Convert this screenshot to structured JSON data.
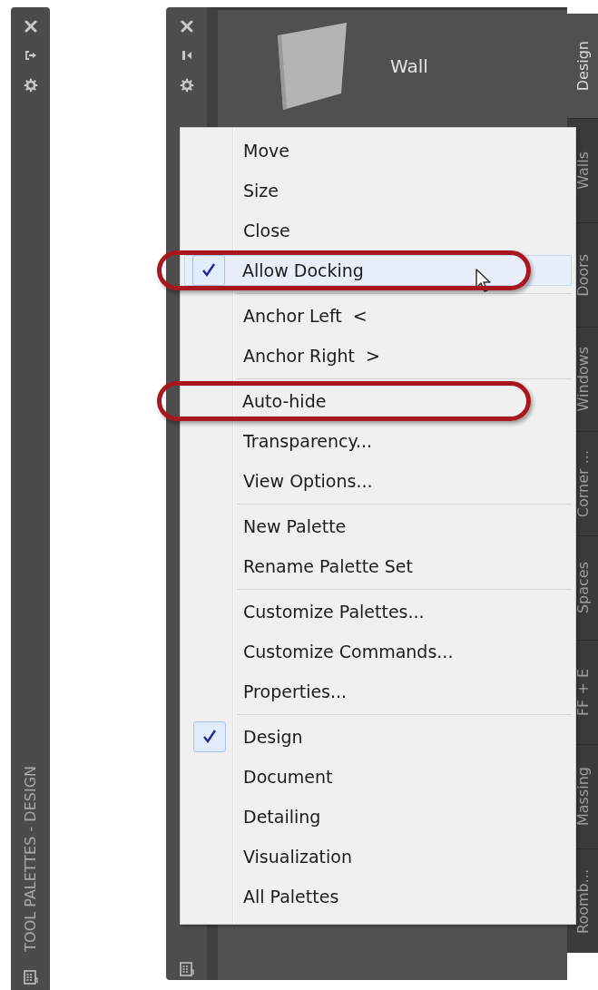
{
  "collapsed_bar": {
    "title": "TOOL PALETTES - DESIGN"
  },
  "palette": {
    "tool": {
      "label": "Wall"
    },
    "tabs": [
      {
        "label": "Design",
        "selected": true
      },
      {
        "label": "Walls",
        "selected": false
      },
      {
        "label": "Doors",
        "selected": false
      },
      {
        "label": "Windows",
        "selected": false
      },
      {
        "label": "Corner ...",
        "selected": false
      },
      {
        "label": "Spaces",
        "selected": false
      },
      {
        "label": "FF + E",
        "selected": false
      },
      {
        "label": "Massing",
        "selected": false
      },
      {
        "label": "Roomb...",
        "selected": false
      }
    ]
  },
  "context_menu": {
    "groups": [
      {
        "items": [
          {
            "label": "Move",
            "checked": false,
            "highlighted": false,
            "annotated": false
          },
          {
            "label": "Size",
            "checked": false,
            "highlighted": false,
            "annotated": false
          },
          {
            "label": "Close",
            "checked": false,
            "highlighted": false,
            "annotated": false
          },
          {
            "label": "Allow Docking",
            "checked": true,
            "highlighted": true,
            "annotated": true
          }
        ]
      },
      {
        "items": [
          {
            "label": "Anchor Left  <",
            "checked": false,
            "highlighted": false,
            "annotated": false
          },
          {
            "label": "Anchor Right  >",
            "checked": false,
            "highlighted": false,
            "annotated": false
          }
        ]
      },
      {
        "items": [
          {
            "label": "Auto-hide",
            "checked": false,
            "highlighted": false,
            "annotated": true
          },
          {
            "label": "Transparency...",
            "checked": false,
            "highlighted": false,
            "annotated": false
          },
          {
            "label": "View Options...",
            "checked": false,
            "highlighted": false,
            "annotated": false
          }
        ]
      },
      {
        "items": [
          {
            "label": "New Palette",
            "checked": false,
            "highlighted": false,
            "annotated": false
          },
          {
            "label": "Rename Palette Set",
            "checked": false,
            "highlighted": false,
            "annotated": false
          }
        ]
      },
      {
        "items": [
          {
            "label": "Customize Palettes...",
            "checked": false,
            "highlighted": false,
            "annotated": false
          },
          {
            "label": "Customize Commands...",
            "checked": false,
            "highlighted": false,
            "annotated": false
          },
          {
            "label": "Properties...",
            "checked": false,
            "highlighted": false,
            "annotated": false
          }
        ]
      },
      {
        "items": [
          {
            "label": "Design",
            "checked": true,
            "highlighted": false,
            "annotated": false
          },
          {
            "label": "Document",
            "checked": false,
            "highlighted": false,
            "annotated": false
          },
          {
            "label": "Detailing",
            "checked": false,
            "highlighted": false,
            "annotated": false
          },
          {
            "label": "Visualization",
            "checked": false,
            "highlighted": false,
            "annotated": false
          },
          {
            "label": "All Palettes",
            "checked": false,
            "highlighted": false,
            "annotated": false
          }
        ]
      }
    ]
  }
}
